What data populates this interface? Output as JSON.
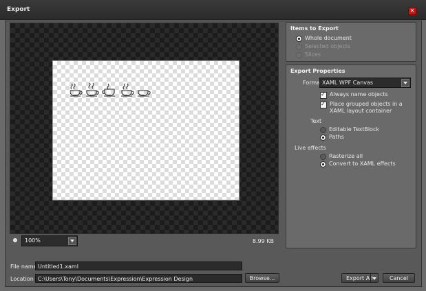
{
  "window": {
    "title": "Export"
  },
  "preview": {
    "zoom_value": "100%",
    "file_size": "8.99 KB"
  },
  "items_to_export": {
    "title": "Items to Export",
    "options": [
      {
        "label": "Whole document",
        "selected": true,
        "enabled": true
      },
      {
        "label": "Selected objects",
        "selected": false,
        "enabled": false
      },
      {
        "label": "Slices",
        "selected": false,
        "enabled": false
      }
    ]
  },
  "export_properties": {
    "title": "Export Properties",
    "format_label": "Format",
    "format_value": "XAML WPF Canvas",
    "checkboxes": [
      {
        "label": "Always name objects",
        "checked": true
      },
      {
        "label": "Place grouped objects in a XAML layout container",
        "checked": true
      }
    ],
    "text_section": {
      "label": "Text",
      "options": [
        {
          "label": "Editable TextBlock",
          "selected": false
        },
        {
          "label": "Paths",
          "selected": true
        }
      ]
    },
    "live_effects_section": {
      "label": "Live effects",
      "options": [
        {
          "label": "Rasterize all",
          "selected": false
        },
        {
          "label": "Convert to XAML effects",
          "selected": true
        }
      ]
    }
  },
  "bottom": {
    "file_name_label": "File name",
    "file_name_value": "Untitled1.xaml",
    "location_label": "Location",
    "location_value": "C:\\Users\\Tony\\Documents\\Expression\\Expression Design",
    "browse_label": "Browse...",
    "export_all_label": "Export All",
    "cancel_label": "Cancel"
  },
  "colors": {
    "titlebar": "#2b2b2b",
    "window_bg": "#595959",
    "panel_bg": "#6a6a6a",
    "close_button": "#c11a1a"
  },
  "icons": [
    "close-icon",
    "coffee-cup-icon",
    "dropdown-arrow-icon",
    "zoom-indicator-icon"
  ]
}
